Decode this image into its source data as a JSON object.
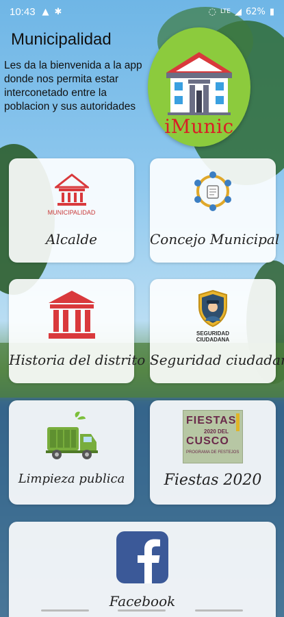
{
  "status_bar": {
    "time": "10:43",
    "battery": "62%",
    "network": "LTE"
  },
  "header": {
    "title": "Municipalidad",
    "subtitle": "Les da la bienvenida a la app donde nos permita estar interconetado entre la poblacion y sus autoridades",
    "logo_text": "iMunic"
  },
  "cards": {
    "alcalde": {
      "label": "Alcalde",
      "icon_caption": "MUNICIPALIDAD",
      "icon": "municipality-icon"
    },
    "concejo": {
      "label": "Concejo Municipal",
      "icon": "council-icon"
    },
    "historia": {
      "label": "Historia del distrito",
      "icon": "building-columns-icon"
    },
    "seguridad": {
      "label": "Seguridad ciudadana",
      "icon_caption_1": "SEGURIDAD",
      "icon_caption_2": "CIUDADANA",
      "icon": "police-shield-icon"
    },
    "limpieza": {
      "label": "Limpieza publica",
      "icon": "garbage-truck-icon"
    },
    "fiestas": {
      "label": "Fiestas 2020",
      "poster_title_1": "FIESTAS",
      "poster_year": "2020 DEL",
      "poster_title_2": "CUSCO",
      "poster_caption": "PROGRAMA DE FESTEJOS",
      "icon": "fiestas-poster"
    },
    "facebook": {
      "label": "Facebook",
      "icon": "facebook-icon"
    }
  },
  "colors": {
    "accent_red": "#d9393c",
    "logo_green": "#8ccb3d",
    "facebook_blue": "#3b5998"
  }
}
